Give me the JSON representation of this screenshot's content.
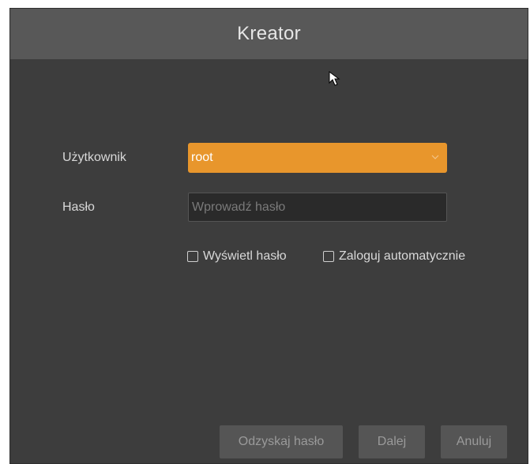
{
  "dialog": {
    "title": "Kreator"
  },
  "form": {
    "user_label": "Użytkownik",
    "user_value": "root",
    "password_label": "Hasło",
    "password_placeholder": "Wprowadź hasło",
    "show_password_label": "Wyświetl hasło",
    "auto_login_label": "Zaloguj automatycznie"
  },
  "buttons": {
    "recover_label": "Odzyskaj hasło",
    "next_label": "Dalej",
    "cancel_label": "Anuluj"
  },
  "colors": {
    "accent": "#e8962c",
    "background": "#3d3d3d",
    "titlebar": "#585858"
  },
  "icons": [
    "chevron-down-icon",
    "checkbox-icon",
    "mouse-cursor-icon"
  ]
}
